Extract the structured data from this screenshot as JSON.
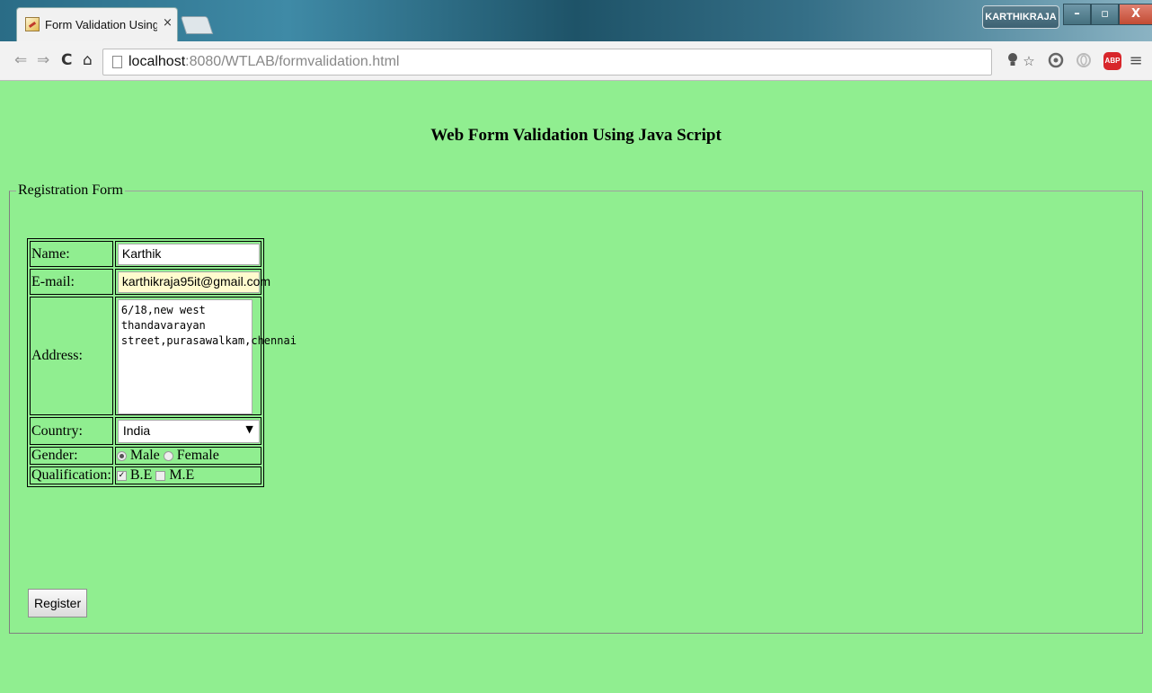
{
  "browser": {
    "tab_title": "Form Validation Using Jav",
    "tab_close": "×",
    "url_host": "localhost",
    "url_rest": ":8080/WTLAB/formvalidation.html",
    "profile_name": "KARTHIKRAJA",
    "window_controls": {
      "minimize": "–",
      "maximize": "▫",
      "close": "X"
    },
    "icons": {
      "back": "⇐",
      "forward": "⇒",
      "reload": "C",
      "home": "⌂",
      "bulb": "bulb-icon",
      "star": "☆",
      "extension1": "extension-icon",
      "extension2": "opera-icon",
      "adblock": "ABP",
      "menu": "≡"
    }
  },
  "page": {
    "heading": "Web Form Validation Using Java Script",
    "legend": "Registration Form",
    "fields": {
      "name_label": "Name:",
      "name_value": "Karthik",
      "email_label": "E-mail:",
      "email_value": "karthikraja95it@gmail.com",
      "address_label": "Address:",
      "address_value": "6/18,new west thandavarayan street,purasawalkam,chennai",
      "country_label": "Country:",
      "country_value": "India",
      "gender_label": "Gender:",
      "gender_male": "Male",
      "gender_female": "Female",
      "gender_selected": "Male",
      "qualification_label": "Qualification:",
      "qual_be": "B.E",
      "qual_me": "M.E",
      "qual_checked": [
        "B.E"
      ]
    },
    "register_label": "Register"
  }
}
